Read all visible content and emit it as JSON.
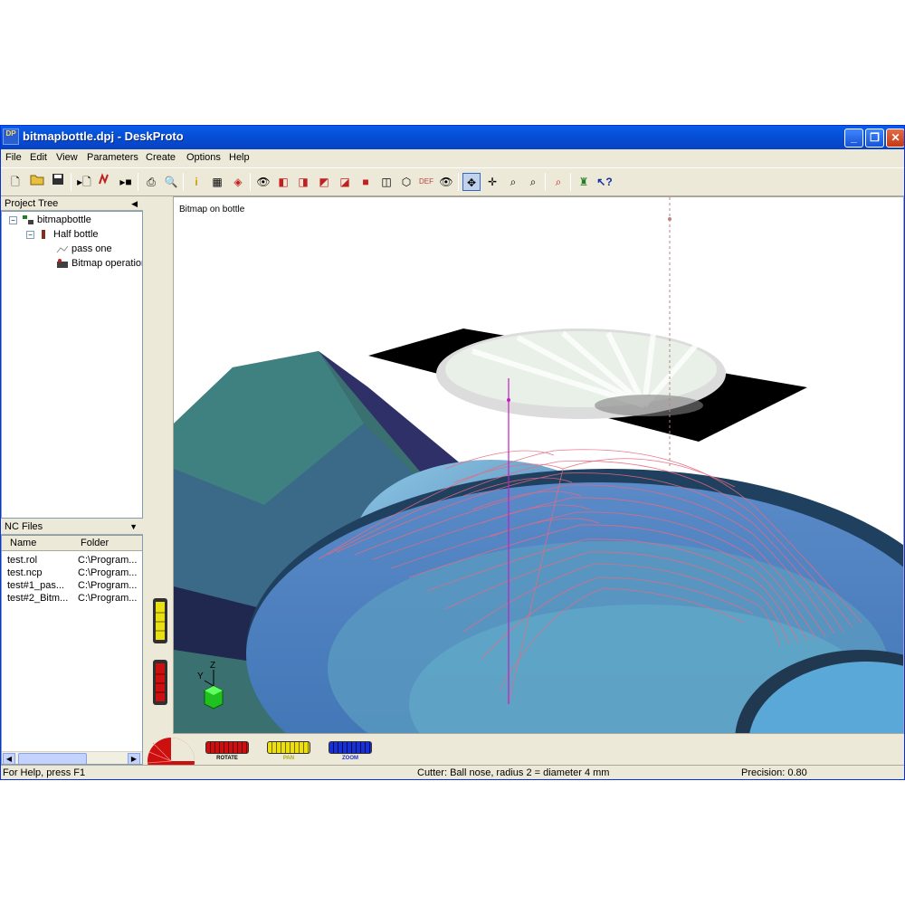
{
  "window": {
    "title": "bitmapbottle.dpj - DeskProto",
    "app_icon": "DP"
  },
  "menu": [
    "File",
    "Edit",
    "View",
    "Parameters",
    "Create",
    "Options",
    "Help"
  ],
  "project_tree": {
    "header": "Project Tree",
    "items": [
      {
        "label": "bitmapbottle",
        "icon": "project-icon"
      },
      {
        "label": "Half bottle",
        "icon": "part-icon"
      },
      {
        "label": "pass one",
        "icon": "operation-icon"
      },
      {
        "label": "Bitmap operation",
        "icon": "bitmap-operation-icon"
      }
    ]
  },
  "nc_files": {
    "header": "NC Files",
    "columns": [
      "Name",
      "Folder"
    ],
    "rows": [
      [
        "test.rol",
        "C:\\Program..."
      ],
      [
        "test.ncp",
        "C:\\Program..."
      ],
      [
        "test#1_pas...",
        "C:\\Program..."
      ],
      [
        "test#2_Bitm...",
        "C:\\Program..."
      ]
    ]
  },
  "viewport": {
    "label": "Bitmap on bottle"
  },
  "axes": {
    "z": "Z",
    "y": "Y"
  },
  "dials": [
    {
      "label": "ROTATE",
      "color": "#cc1010"
    },
    {
      "label": "PAN",
      "color": "#e8e010"
    },
    {
      "label": "ZOOM",
      "color": "#1830d0"
    }
  ],
  "status": {
    "help": "For Help, press F1",
    "cutter": "Cutter: Ball nose, radius 2 = diameter 4 mm",
    "precision": "Precision: 0.80"
  },
  "colors": {
    "titlebar": "#0550d8",
    "toolpath": "#e86a80",
    "model": "#5aa0c8"
  }
}
